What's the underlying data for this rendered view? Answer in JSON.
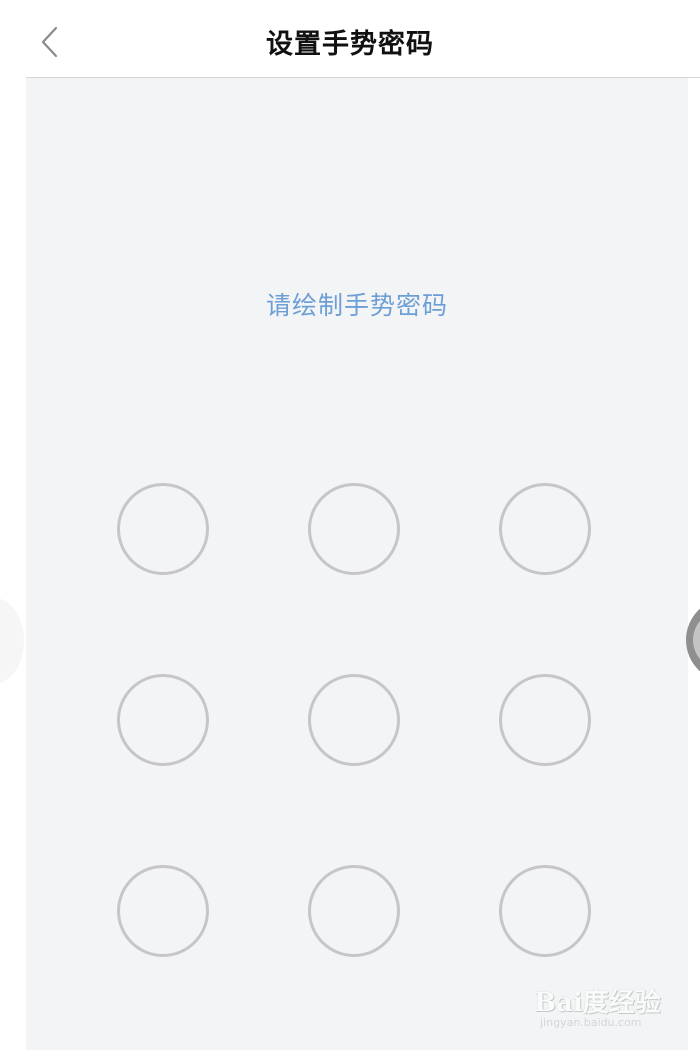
{
  "header": {
    "back_icon": "chevron-left-icon",
    "title": "设置手势密码"
  },
  "main": {
    "hint": "请绘制手势密码",
    "hint_color": "#6d9fd6",
    "pattern_dots": [
      {
        "row": 1,
        "col": 1,
        "selected": false
      },
      {
        "row": 1,
        "col": 2,
        "selected": false
      },
      {
        "row": 1,
        "col": 3,
        "selected": false
      },
      {
        "row": 2,
        "col": 1,
        "selected": false
      },
      {
        "row": 2,
        "col": 2,
        "selected": false
      },
      {
        "row": 2,
        "col": 3,
        "selected": false
      },
      {
        "row": 3,
        "col": 1,
        "selected": false
      },
      {
        "row": 3,
        "col": 2,
        "selected": false
      },
      {
        "row": 3,
        "col": 3,
        "selected": false
      }
    ],
    "dot_border_color": "#c6c6c8",
    "background_color": "#f3f4f6"
  },
  "watermark": {
    "brand": "Bai度经验",
    "url": "jingyan.baidu.com"
  }
}
